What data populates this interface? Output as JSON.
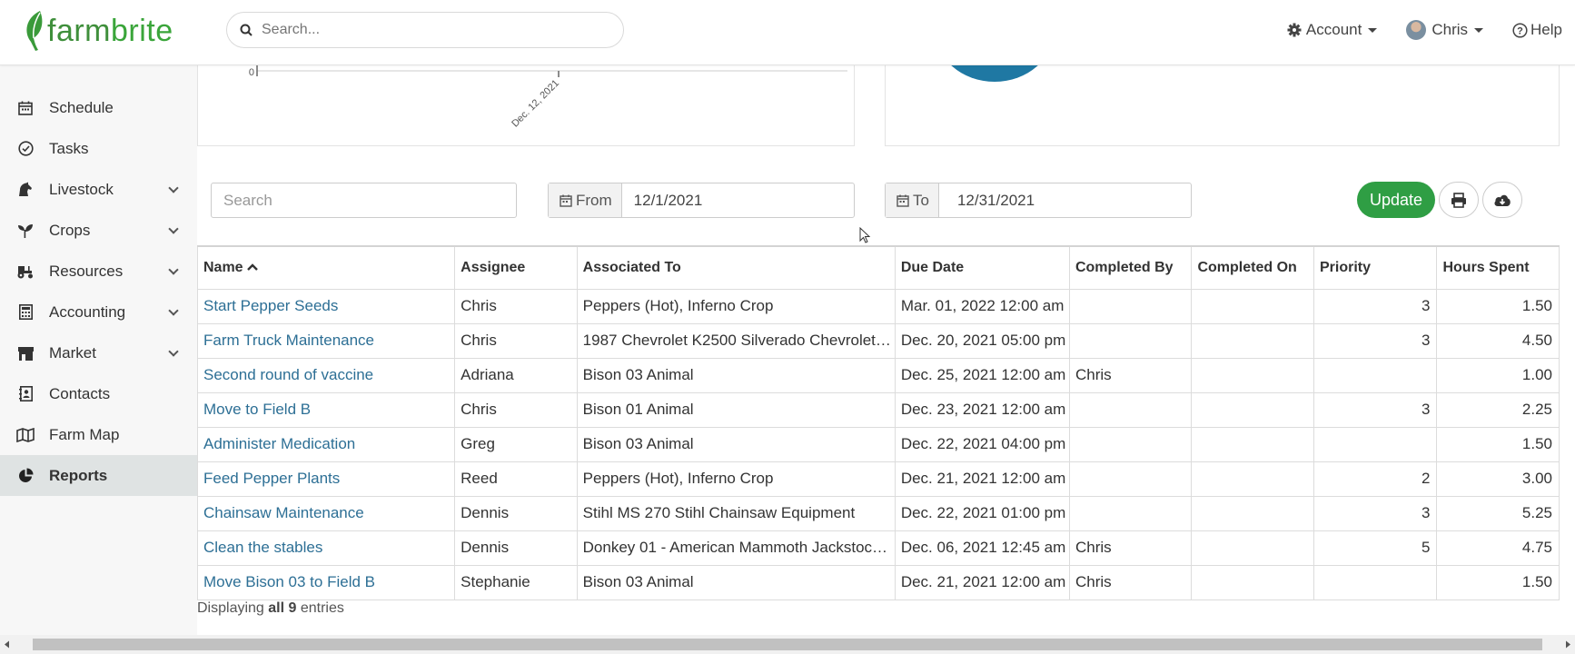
{
  "brand": {
    "name_part1": "farm",
    "name_part2": "brite",
    "leaf_color": "#3a9a3a"
  },
  "header": {
    "search_placeholder": "Search...",
    "account_label": "Account",
    "user_label": "Chris",
    "help_label": "Help"
  },
  "sidebar": {
    "items": [
      {
        "label": "Schedule",
        "icon": "calendar-icon"
      },
      {
        "label": "Tasks",
        "icon": "check-circle-icon"
      },
      {
        "label": "Livestock",
        "icon": "horse-icon"
      },
      {
        "label": "Crops",
        "icon": "seedling-icon"
      },
      {
        "label": "Resources",
        "icon": "tractor-icon"
      },
      {
        "label": "Accounting",
        "icon": "calculator-icon"
      },
      {
        "label": "Market",
        "icon": "store-icon"
      },
      {
        "label": "Contacts",
        "icon": "address-book-icon"
      },
      {
        "label": "Farm Map",
        "icon": "map-icon"
      },
      {
        "label": "Reports",
        "icon": "pie-chart-icon"
      }
    ],
    "active": "Reports"
  },
  "chart_data": {
    "type": "line",
    "x": [
      "Dec. 12, 2021"
    ],
    "y_tick": "0",
    "title": ""
  },
  "filters": {
    "search_placeholder": "Search",
    "from_label": "From",
    "from_value": "12/1/2021",
    "to_label": "To",
    "to_value": "12/31/2021",
    "update_label": "Update"
  },
  "table": {
    "headers": [
      "Name",
      "Assignee",
      "Associated To",
      "Due Date",
      "Completed By",
      "Completed On",
      "Priority",
      "Hours Spent"
    ],
    "rows": [
      [
        "Start Pepper Seeds",
        "Chris",
        "Peppers (Hot), Inferno Crop",
        "Mar. 01, 2022 12:00 am",
        "",
        "",
        "3",
        "1.50"
      ],
      [
        "Farm Truck Maintenance",
        "Chris",
        "1987 Chevrolet K2500 Silverado Chevrolet…",
        "Dec. 20, 2021 05:00 pm",
        "",
        "",
        "3",
        "4.50"
      ],
      [
        "Second round of vaccine",
        "Adriana",
        "Bison 03 Animal",
        "Dec. 25, 2021 12:00 am",
        "Chris",
        "",
        "",
        "1.00"
      ],
      [
        "Move to Field B",
        "Chris",
        "Bison 01 Animal",
        "Dec. 23, 2021 12:00 am",
        "",
        "",
        "3",
        "2.25"
      ],
      [
        "Administer Medication",
        "Greg",
        "Bison 03 Animal",
        "Dec. 22, 2021 04:00 pm",
        "",
        "",
        "",
        "1.50"
      ],
      [
        "Feed Pepper Plants",
        "Reed",
        "Peppers (Hot), Inferno Crop",
        "Dec. 21, 2021 12:00 am",
        "",
        "",
        "2",
        "3.00"
      ],
      [
        "Chainsaw Maintenance",
        "Dennis",
        "Stihl MS 270 Stihl Chainsaw Equipment",
        "Dec. 22, 2021 01:00 pm",
        "",
        "",
        "3",
        "5.25"
      ],
      [
        "Clean the stables",
        "Dennis",
        "Donkey 01 - American Mammoth Jackstoc…",
        "Dec. 06, 2021 12:45 am",
        "Chris",
        "",
        "5",
        "4.75"
      ],
      [
        "Move Bison 03 to Field B",
        "Stephanie",
        "Bison 03 Animal",
        "Dec. 21, 2021 12:00 am",
        "Chris",
        "",
        "",
        "1.50"
      ]
    ]
  },
  "footer": {
    "prefix": "Displaying",
    "strong": "all 9",
    "suffix": "entries"
  },
  "colors": {
    "accent_green": "#2f9e44",
    "link_blue": "#2d6f95",
    "pie_blue": "#1f78a3"
  }
}
